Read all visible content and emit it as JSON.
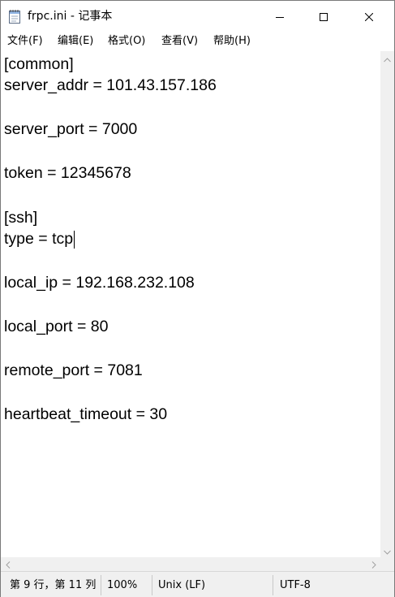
{
  "window": {
    "title": "frpc.ini - 记事本",
    "icon": "notepad-icon",
    "controls": {
      "minimize": "minimize-icon",
      "maximize": "maximize-icon",
      "close": "close-icon"
    }
  },
  "menu": {
    "items": [
      "文件(F)",
      "编辑(E)",
      "格式(O)",
      "查看(V)",
      "帮助(H)"
    ]
  },
  "editor": {
    "lines": [
      "[common]",
      "server_addr = 101.43.157.186",
      "server_port = 7000",
      "token = 12345678",
      "[ssh]",
      "type = tcp",
      "local_ip = 192.168.232.108",
      "local_port = 80",
      "remote_port = 7081",
      "heartbeat_timeout = 30"
    ]
  },
  "status": {
    "position": "第 9 行，第 11 列",
    "zoom": "100%",
    "line_ending": "Unix (LF)",
    "encoding": "UTF-8"
  }
}
